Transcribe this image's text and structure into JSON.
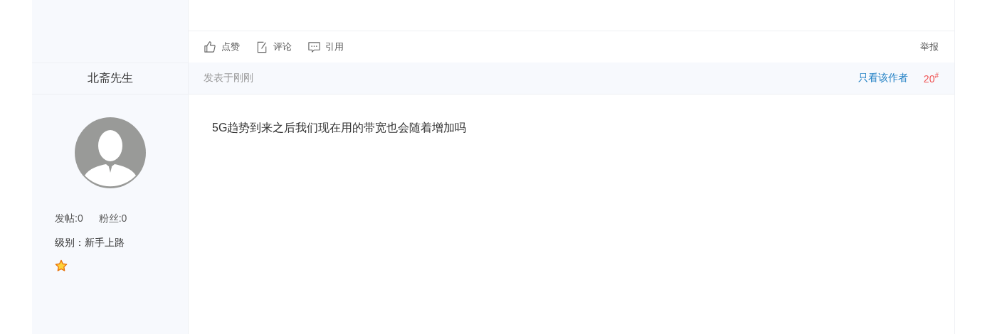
{
  "post_actions": [
    {
      "kind": "like",
      "label": "点赞"
    },
    {
      "kind": "comment",
      "label": "评论"
    },
    {
      "kind": "quote",
      "label": "引用"
    }
  ],
  "report": "举报",
  "author": {
    "name": "北斋先生",
    "stats": [
      "发帖:0",
      "粉丝:0"
    ],
    "level": "级别：新手上路"
  },
  "post_header": {
    "time": "发表于刚刚",
    "only_author": "只看该作者",
    "floor": "20$^{#}$"
  },
  "post_body": "5G趋势到来之后我们现在用的带宽也会随着增加吗"
}
